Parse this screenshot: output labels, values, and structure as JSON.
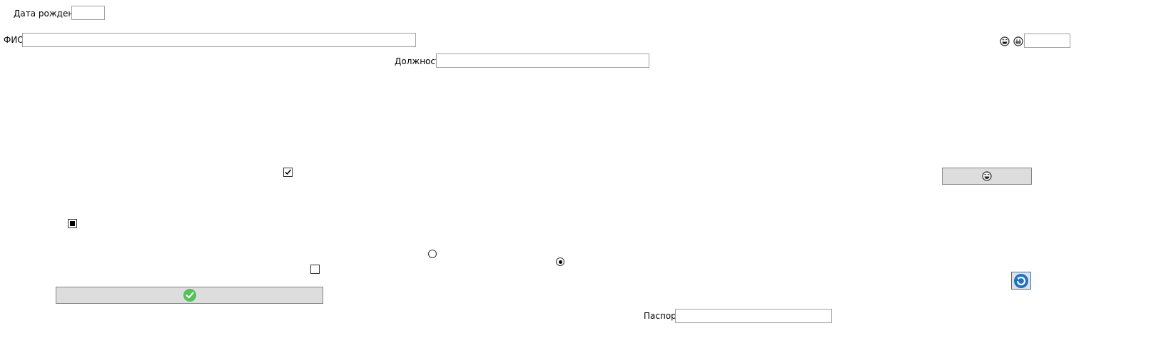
{
  "form": {
    "birth_date": {
      "label": "Дата рождения",
      "value": ""
    },
    "full_name": {
      "label": "ФИО",
      "value": ""
    },
    "position": {
      "label": "Должность",
      "value": ""
    },
    "passport": {
      "label": "Паспорт",
      "value": ""
    },
    "emoji_field": {
      "value": ""
    }
  },
  "checkboxes": [
    {
      "name": "checkbox-1",
      "state": "checked"
    },
    {
      "name": "checkbox-2",
      "state": "indeterminate"
    },
    {
      "name": "checkbox-3",
      "state": "unchecked"
    }
  ],
  "radios": [
    {
      "name": "radio-1",
      "selected": false
    },
    {
      "name": "radio-2",
      "selected": true
    }
  ],
  "icons": {
    "smiley_1": "laughing-face-icon",
    "smiley_2": "grinning-face-icon",
    "smiley_button": "laughing-face-icon",
    "confirm_button": "green-checkmark-icon",
    "refresh_button": "blue-refresh-icon"
  },
  "colors": {
    "button_bg": "#dddddd",
    "checkmark_green": "#52c15a",
    "refresh_blue": "#1a73c8"
  }
}
